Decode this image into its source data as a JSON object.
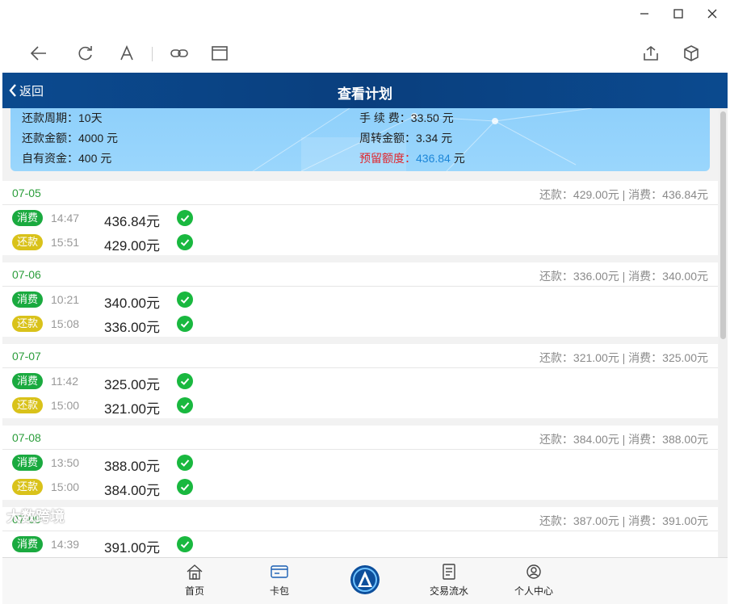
{
  "nav": {
    "back_label": "返回",
    "title": "查看计划"
  },
  "summary": {
    "cycle": "还款周期：10天",
    "amount": "还款金额：4000 元",
    "own_funds": "自有资金：400 元",
    "fee": "手 续 费：33.50 元",
    "turnover": "周转金额：3.34 元",
    "reserve_label": "预留额度：",
    "reserve_value": "436.84",
    "reserve_unit": " 元"
  },
  "groups": [
    {
      "date": "07-05",
      "sum": "还款：429.00元 | 消费：436.84元",
      "rows": [
        {
          "tag": "消费",
          "time": "14:47",
          "amount": "436.84元"
        },
        {
          "tag": "还款",
          "time": "15:51",
          "amount": "429.00元"
        }
      ]
    },
    {
      "date": "07-06",
      "sum": "还款：336.00元 | 消费：340.00元",
      "rows": [
        {
          "tag": "消费",
          "time": "10:21",
          "amount": "340.00元"
        },
        {
          "tag": "还款",
          "time": "15:08",
          "amount": "336.00元"
        }
      ]
    },
    {
      "date": "07-07",
      "sum": "还款：321.00元 | 消费：325.00元",
      "rows": [
        {
          "tag": "消费",
          "time": "11:42",
          "amount": "325.00元"
        },
        {
          "tag": "还款",
          "time": "15:00",
          "amount": "321.00元"
        }
      ]
    },
    {
      "date": "07-08",
      "sum": "还款：384.00元 | 消费：388.00元",
      "rows": [
        {
          "tag": "消费",
          "time": "13:50",
          "amount": "388.00元"
        },
        {
          "tag": "还款",
          "time": "15:00",
          "amount": "384.00元"
        }
      ]
    },
    {
      "date": "07-09",
      "sum": "还款：387.00元 | 消费：391.00元",
      "rows": [
        {
          "tag": "消费",
          "time": "14:39",
          "amount": "391.00元"
        }
      ]
    }
  ],
  "tabs": [
    {
      "label": "首页",
      "icon": "home-icon"
    },
    {
      "label": "卡包",
      "icon": "card-icon"
    },
    {
      "label": "交易流水",
      "icon": "receipt-icon"
    },
    {
      "label": "个人中心",
      "icon": "profile-icon"
    }
  ],
  "watermark": "大数跨境",
  "colors": {
    "nav": "#0b4a8f",
    "consume": "#1aaa3f",
    "repay": "#d9c21a",
    "date": "#2a9d3a"
  }
}
